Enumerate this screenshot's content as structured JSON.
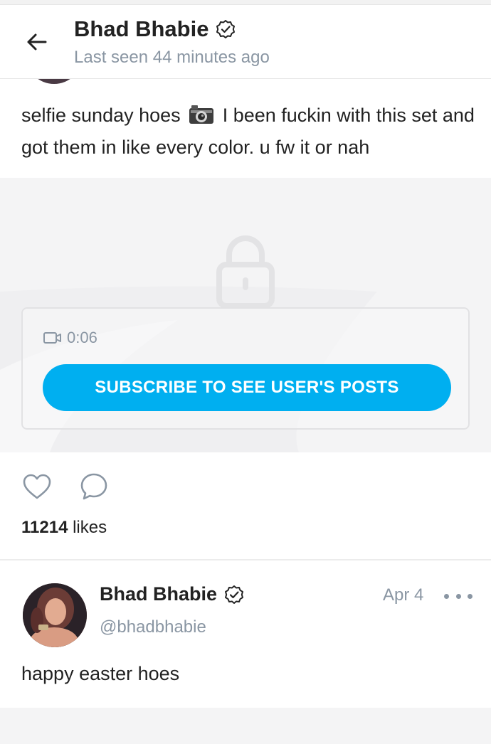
{
  "header": {
    "title": "Bhad Bhabie",
    "subtitle": "Last seen 44 minutes ago"
  },
  "post1": {
    "text_before": "selfie sunday hoes",
    "text_after": "I been fuckin with this set and got them in like every color. u fw it or nah",
    "media": {
      "duration": "0:06",
      "subscribe_label": "SUBSCRIBE TO SEE USER'S POSTS"
    },
    "likes_count": "11214",
    "likes_label": "likes"
  },
  "post2": {
    "name": "Bhad Bhabie",
    "handle": "@bhadbhabie",
    "date": "Apr 4",
    "text": "happy easter hoes"
  },
  "colors": {
    "accent": "#00aff0",
    "muted": "#8a96a3",
    "locked_bg": "#f4f4f5"
  }
}
